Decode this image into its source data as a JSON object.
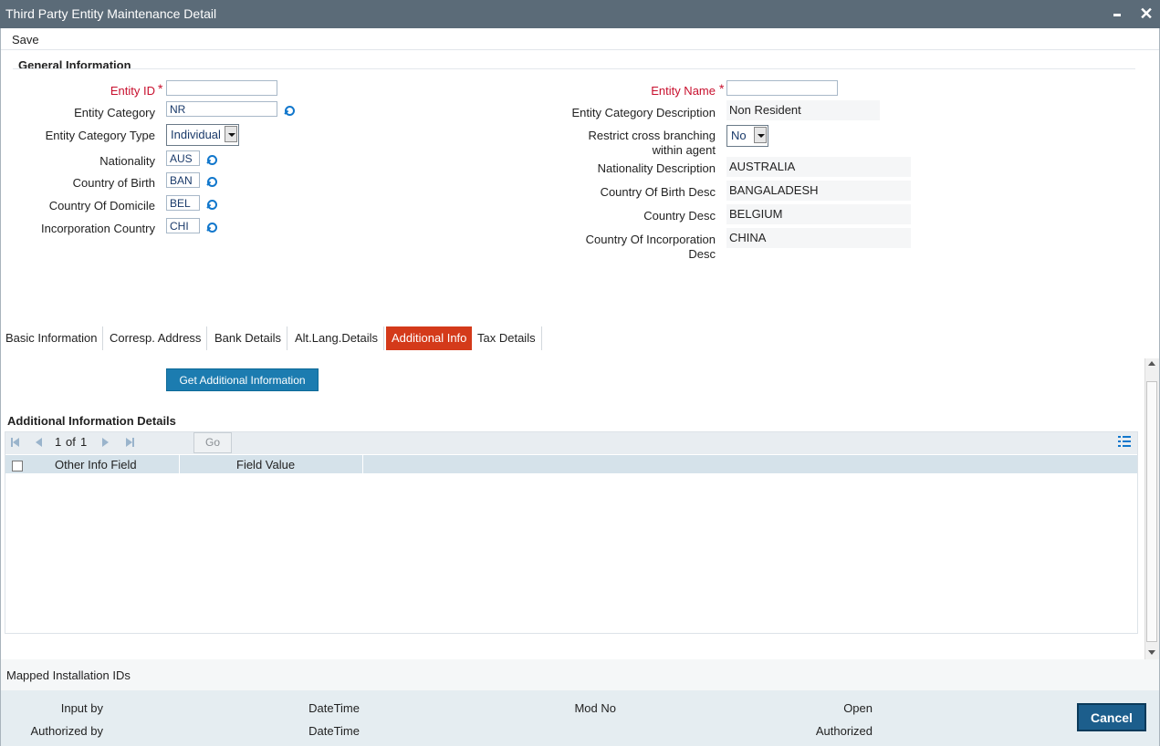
{
  "window": {
    "title": "Third Party Entity Maintenance Detail"
  },
  "toolbar": {
    "save_label": "Save"
  },
  "general": {
    "section_title": "General Information",
    "left": {
      "entity_id": {
        "label": "Entity ID",
        "value": ""
      },
      "entity_category": {
        "label": "Entity Category",
        "value": "NR"
      },
      "entity_category_type": {
        "label": "Entity Category Type",
        "value": "Individual"
      },
      "nationality": {
        "label": "Nationality",
        "value": "AUS"
      },
      "country_of_birth": {
        "label": "Country of Birth",
        "value": "BAN"
      },
      "country_of_domicile": {
        "label": "Country Of Domicile",
        "value": "BEL"
      },
      "incorporation_country": {
        "label": "Incorporation Country",
        "value": "CHI"
      }
    },
    "right": {
      "entity_name": {
        "label": "Entity Name",
        "value": ""
      },
      "entity_category_description": {
        "label": "Entity Category Description",
        "value": "Non Resident"
      },
      "restrict_cross_branching": {
        "label_line1": "Restrict cross branching",
        "label_line2": "within agent",
        "value": "No"
      },
      "nationality_description": {
        "label": "Nationality Description",
        "value": "AUSTRALIA"
      },
      "country_of_birth_desc": {
        "label": "Country Of Birth Desc",
        "value": "BANGALADESH"
      },
      "country_desc": {
        "label": "Country Desc",
        "value": "BELGIUM"
      },
      "country_of_incorporation_desc": {
        "label_line1": "Country Of Incorporation",
        "label_line2": "Desc",
        "value": "CHINA"
      }
    }
  },
  "tabs": [
    {
      "label": "Basic Information",
      "active": false
    },
    {
      "label": "Corresp. Address",
      "active": false
    },
    {
      "label": "Bank Details",
      "active": false
    },
    {
      "label": "Alt.Lang.Details",
      "active": false
    },
    {
      "label": "Additional Info",
      "active": true
    },
    {
      "label": "Tax Details",
      "active": false
    }
  ],
  "additional_info": {
    "get_button_label": "Get Additional Information",
    "details_title": "Additional Information Details",
    "pager": {
      "current": "1",
      "of_label": "of",
      "total": "1",
      "go_label": "Go"
    },
    "columns": [
      "Other Info Field",
      "Field Value"
    ],
    "rows": []
  },
  "mapped_installation": {
    "label": "Mapped Installation IDs"
  },
  "footer": {
    "input_by": "Input by",
    "authorized_by": "Authorized by",
    "datetime_1": "DateTime",
    "datetime_2": "DateTime",
    "mod_no": "Mod No",
    "open": "Open",
    "authorized": "Authorized",
    "cancel_label": "Cancel"
  },
  "colors": {
    "titlebar": "#5b6b78",
    "required": "#c8102e",
    "active_tab": "#d43a1a",
    "primary_button": "#1c7cb0",
    "cancel_button": "#1c5e8c"
  }
}
